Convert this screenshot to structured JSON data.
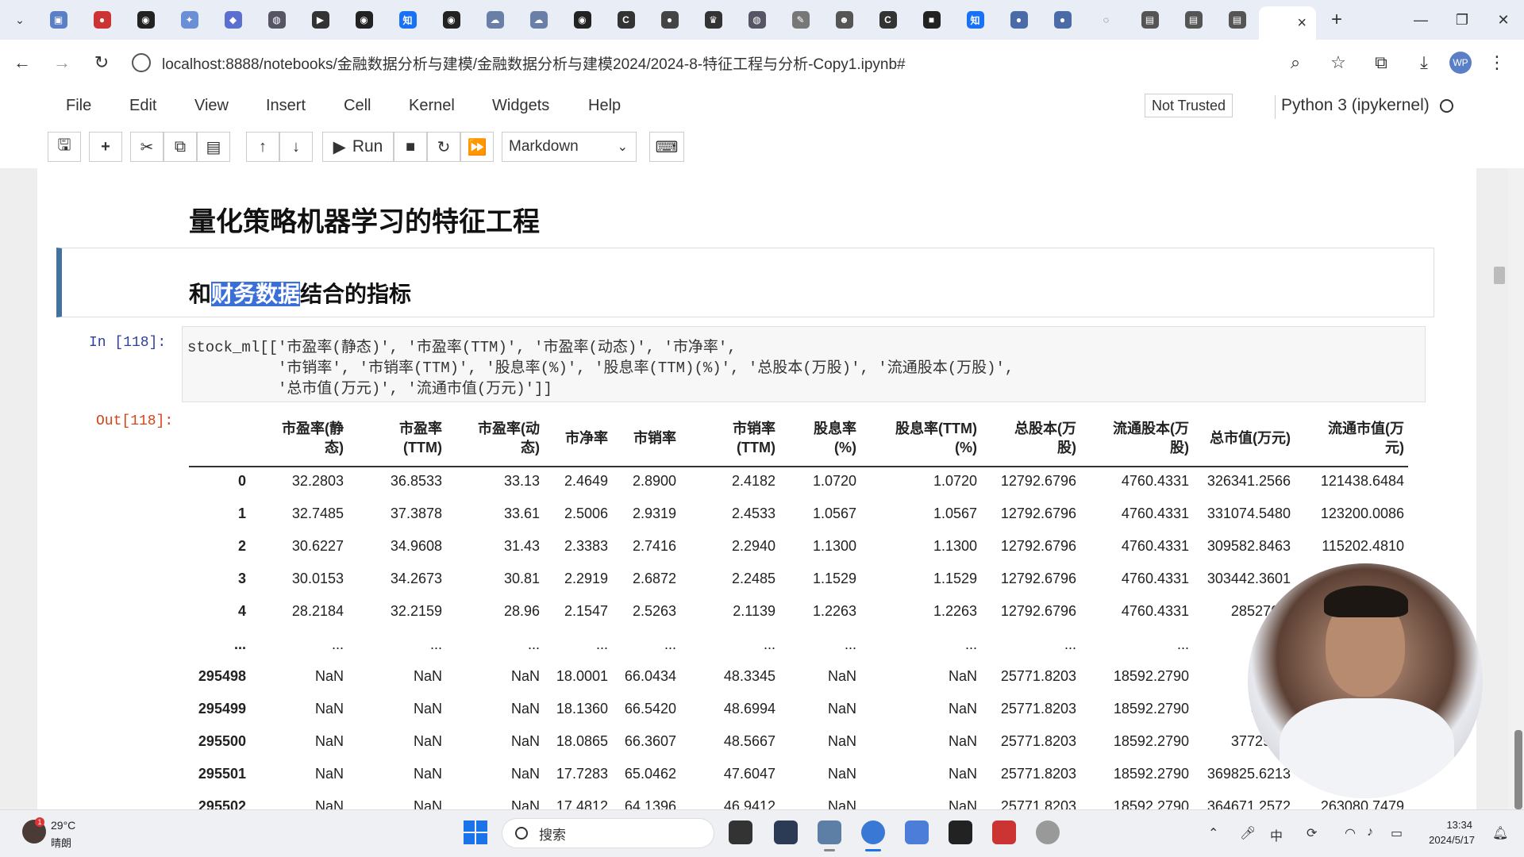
{
  "browser": {
    "tab_close": "×",
    "new_tab": "+",
    "url": "localhost:8888/notebooks/金融数据分析与建模/金融数据分析与建模2024/2024-8-特征工程与分析-Copy1.ipynb#",
    "profile_initials": "WP"
  },
  "jupyter": {
    "menu": [
      "File",
      "Edit",
      "View",
      "Insert",
      "Cell",
      "Kernel",
      "Widgets",
      "Help"
    ],
    "trust_label": "Not Trusted",
    "kernel_label": "Python 3 (ipykernel)",
    "toolbar": {
      "run_label": "Run",
      "cell_type": "Markdown"
    }
  },
  "notebook": {
    "heading1": "量化策略机器学习的特征工程",
    "heading2_prefix": "和",
    "heading2_highlight": "财务数据",
    "heading2_suffix": "结合的指标",
    "in_prompt": "In  [118]:",
    "out_prompt": "Out[118]:",
    "code_lines": [
      "stock_ml[['市盈率(静态)', '市盈率(TTM)', '市盈率(动态)', '市净率',",
      "          '市销率', '市销率(TTM)', '股息率(%)', '股息率(TTM)(%)', '总股本(万股)', '流通股本(万股)',",
      "          '总市值(万元)', '流通市值(万元)']]"
    ]
  },
  "dataframe": {
    "columns": [
      [
        "市盈率(静",
        "态)"
      ],
      [
        "市盈率",
        "(TTM)"
      ],
      [
        "市盈率(动",
        "态)"
      ],
      [
        "市净率"
      ],
      [
        "市销率"
      ],
      [
        "市销率",
        "(TTM)"
      ],
      [
        "股息率",
        "(%)"
      ],
      [
        "股息率(TTM)",
        "(%)"
      ],
      [
        "总股本(万",
        "股)"
      ],
      [
        "流通股本(万",
        "股)"
      ],
      [
        "总市值(万元)"
      ],
      [
        "流通市值(万",
        "元)"
      ]
    ],
    "rows": [
      {
        "index": "0",
        "values": [
          "32.2803",
          "36.8533",
          "33.13",
          "2.4649",
          "2.8900",
          "2.4182",
          "1.0720",
          "1.0720",
          "12792.6796",
          "4760.4331",
          "326341.2566",
          "121438.6484"
        ]
      },
      {
        "index": "1",
        "values": [
          "32.7485",
          "37.3878",
          "33.61",
          "2.5006",
          "2.9319",
          "2.4533",
          "1.0567",
          "1.0567",
          "12792.6796",
          "4760.4331",
          "331074.5480",
          "123200.0086"
        ]
      },
      {
        "index": "2",
        "values": [
          "30.6227",
          "34.9608",
          "31.43",
          "2.3383",
          "2.7416",
          "2.2940",
          "1.1300",
          "1.1300",
          "12792.6796",
          "4760.4331",
          "309582.8463",
          "115202.4810"
        ]
      },
      {
        "index": "3",
        "values": [
          "30.0153",
          "34.2673",
          "30.81",
          "2.2919",
          "2.6872",
          "2.2485",
          "1.1529",
          "1.1529",
          "12792.6796",
          "4760.4331",
          "303442.3601",
          ""
        ]
      },
      {
        "index": "4",
        "values": [
          "28.2184",
          "32.2159",
          "28.96",
          "2.1547",
          "2.5263",
          "2.1139",
          "1.2263",
          "1.2263",
          "12792.6796",
          "4760.4331",
          "285276.7",
          ""
        ]
      },
      {
        "index": "...",
        "values": [
          "...",
          "...",
          "...",
          "...",
          "...",
          "...",
          "...",
          "...",
          "...",
          "...",
          "",
          ""
        ]
      },
      {
        "index": "295498",
        "values": [
          "NaN",
          "NaN",
          "NaN",
          "18.0001",
          "66.0434",
          "48.3345",
          "NaN",
          "NaN",
          "25771.8203",
          "18592.2790",
          "37549",
          ""
        ]
      },
      {
        "index": "295499",
        "values": [
          "NaN",
          "NaN",
          "NaN",
          "18.1360",
          "66.5420",
          "48.6994",
          "NaN",
          "NaN",
          "25771.8203",
          "18592.2790",
          "37833",
          ""
        ]
      },
      {
        "index": "295500",
        "values": [
          "NaN",
          "NaN",
          "NaN",
          "18.0865",
          "66.3607",
          "48.5667",
          "NaN",
          "NaN",
          "25771.8203",
          "18592.2790",
          "377299.4",
          ""
        ]
      },
      {
        "index": "295501",
        "values": [
          "NaN",
          "NaN",
          "NaN",
          "17.7283",
          "65.0462",
          "47.6047",
          "NaN",
          "NaN",
          "25771.8203",
          "18592.2790",
          "369825.6213",
          ""
        ]
      },
      {
        "index": "295502",
        "values": [
          "NaN",
          "NaN",
          "NaN",
          "17.4812",
          "64.1396",
          "46.9412",
          "NaN",
          "NaN",
          "25771.8203",
          "18592.2790",
          "364671.2572",
          "263080.7479"
        ]
      }
    ]
  },
  "taskbar": {
    "weather_badge": "1",
    "temperature": "29°C",
    "weather": "晴朗",
    "search_label": "搜索",
    "time": "13:34",
    "date": "2024/5/17"
  },
  "colors": {
    "md_border": "#42729e",
    "highlight": "#3a6fd8",
    "in_prompt": "#303f9f",
    "out_prompt": "#d84315"
  }
}
